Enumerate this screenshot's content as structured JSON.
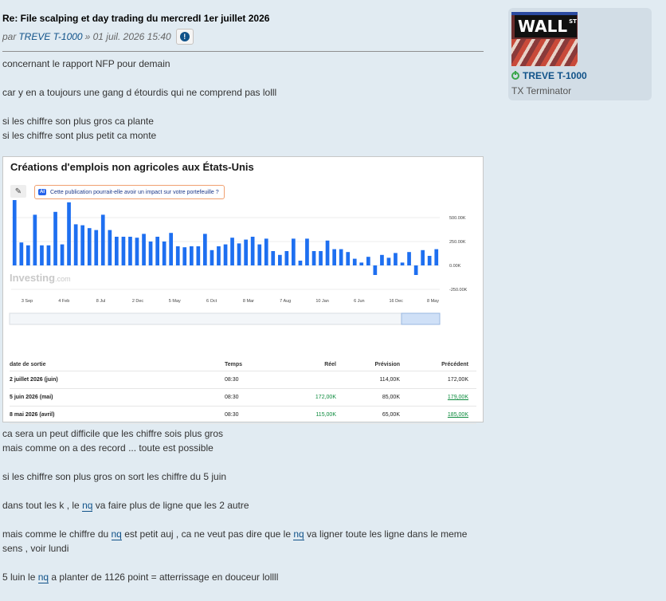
{
  "post": {
    "title": "Re: File scalping et day trading du mercredI 1er juillet 2026",
    "by": "par",
    "author": "TREVE T-1000",
    "date": "» 01 juil. 2026 15:40",
    "report_icon": "!"
  },
  "profile": {
    "username": "TREVE T-1000",
    "rank": "TX Terminator",
    "avatar_text": "WALL",
    "avatar_sup": "ST"
  },
  "body_top": [
    "concernant le rapport NFP pour demain",
    "",
    "car y en a toujours une gang d étourdis qui ne comprend pas lolll",
    "",
    "si les chiffre son plus gros ca plante",
    "si les chiffre sont plus petit ca monte"
  ],
  "embed": {
    "title": "Créations d'emplois non agricoles aux États-Unis",
    "ai_badge": "AI",
    "ai_prompt": "Cette publication pourrait-elle avoir un impact sur votre portefeuille ?",
    "watermark_main": "Investing",
    "watermark_suffix": ".com",
    "table": {
      "headers": [
        "date de sortie",
        "Temps",
        "Réel",
        "Prévision",
        "Précédent"
      ],
      "rows": [
        [
          "2 juillet 2026 (juin)",
          "08:30",
          "",
          "114,00K",
          "172,00K"
        ],
        [
          "5 juin 2026 (mai)",
          "08:30",
          "172,00K",
          "85,00K",
          "179,00K"
        ],
        [
          "8 mai 2026 (avril)",
          "08:30",
          "115,00K",
          "65,00K",
          "185,00K"
        ]
      ]
    }
  },
  "chart_data": {
    "type": "bar",
    "title": "Créations d'emplois non agricoles aux États-Unis",
    "x_ticks": [
      "3 Sep",
      "4 Feb",
      "8 Jul",
      "2 Dec",
      "5 May",
      "6 Oct",
      "8 Mar",
      "7 Aug",
      "10 Jan",
      "6 Jun",
      "16 Dec",
      "8 May"
    ],
    "y_ticks": [
      "500.00K",
      "250.00K",
      "0.00K",
      "-250.00K"
    ],
    "ylim": [
      -250,
      700
    ],
    "values": [
      690,
      240,
      210,
      530,
      210,
      210,
      560,
      220,
      660,
      430,
      420,
      390,
      370,
      530,
      370,
      300,
      300,
      300,
      290,
      330,
      250,
      300,
      250,
      340,
      200,
      190,
      200,
      200,
      330,
      160,
      200,
      220,
      290,
      230,
      270,
      300,
      220,
      280,
      150,
      110,
      150,
      280,
      50,
      280,
      150,
      150,
      260,
      170,
      170,
      140,
      70,
      30,
      90,
      -100,
      110,
      80,
      130,
      30,
      140,
      -100,
      160,
      100,
      170
    ],
    "bar_color": "#1e6ff0"
  },
  "body_bottom": [
    {
      "text": "ca sera un peut difficile que les chiffre sois plus gros"
    },
    {
      "text": "mais comme on a des record ... toute est possible"
    },
    {
      "text": ""
    },
    {
      "text": "si les chiffre son plus gros on sort les chiffre du 5 juin"
    },
    {
      "text": ""
    }
  ],
  "line_k": {
    "pre": "dans tout les k , le ",
    "kw": "nq",
    "post": " va faire plus de ligne que les 2 autre"
  },
  "line_petit": {
    "pre": "mais comme le chiffre du ",
    "kw1": "nq",
    "mid": " est petit auj , ca ne veut pas dire que le ",
    "kw2": "nq",
    "post": " va ligner toute les ligne dans le meme"
  },
  "line_sens": "sens , voir lundi",
  "line_luin": {
    "pre": "5 luin le ",
    "kw": "nq",
    "post": " a planter de 1126 point = atterrissage en douceur lollll"
  }
}
